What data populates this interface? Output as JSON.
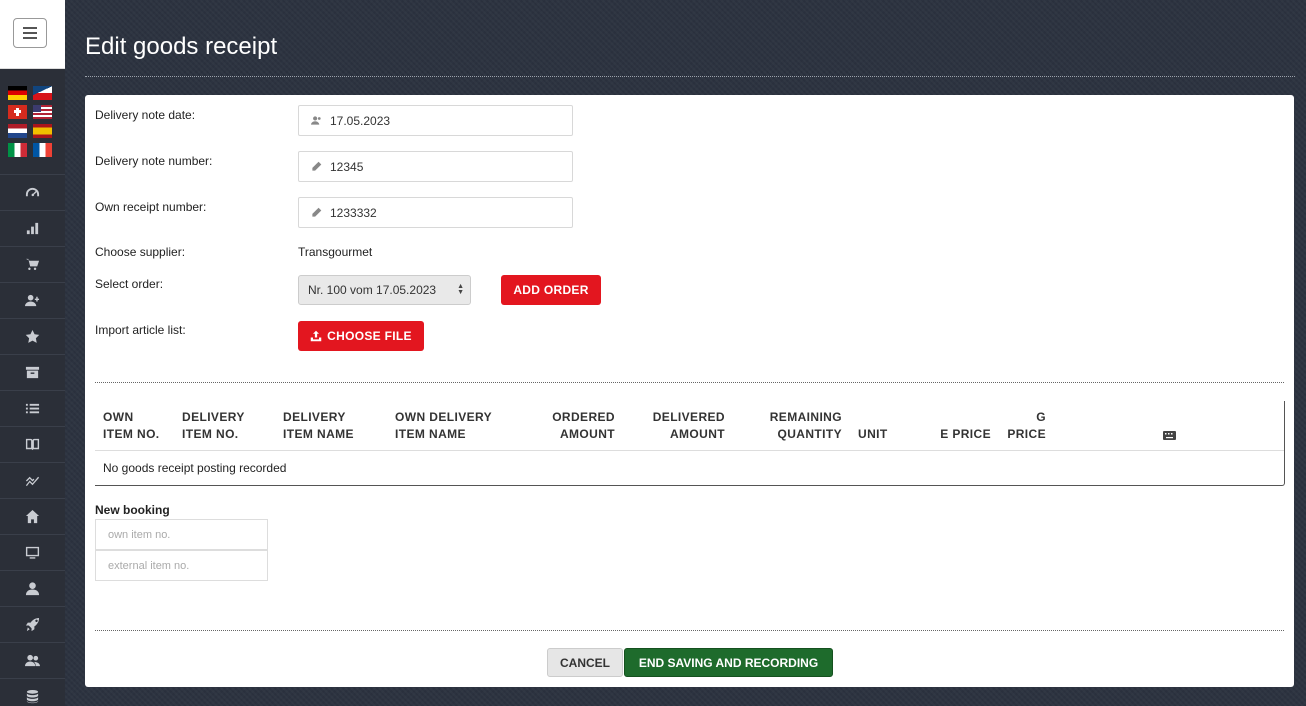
{
  "page": {
    "title": "Edit goods receipt"
  },
  "sidebar": {
    "flags": [
      "de",
      "cz",
      "ch",
      "us",
      "nl",
      "es",
      "it",
      "fr"
    ],
    "nav_icons": [
      "dashboard-icon",
      "bar-chart-icon",
      "shopping-cart-icon",
      "add-user-icon",
      "star-icon",
      "archive-icon",
      "list-icon",
      "book-icon",
      "trend-icon",
      "home-icon",
      "monitor-icon",
      "user-icon",
      "rocket-icon",
      "users-icon",
      "database-icon"
    ]
  },
  "form": {
    "delivery_date_label": "Delivery note date:",
    "delivery_date_value": "17.05.2023",
    "delivery_number_label": "Delivery note number:",
    "delivery_number_value": "12345",
    "own_receipt_label": "Own receipt number:",
    "own_receipt_value": "1233332",
    "supplier_label": "Choose supplier:",
    "supplier_value": "Transgourmet",
    "order_label": "Select order:",
    "order_value": "Nr. 100 vom 17.05.2023",
    "add_order_label": "ADD ORDER",
    "import_label": "Import article list:",
    "choose_file_label": "CHOOSE FILE"
  },
  "table": {
    "headers": {
      "own_item_no": [
        "OWN",
        "ITEM NO."
      ],
      "delivery_item_no": [
        "DELIVERY",
        "ITEM NO."
      ],
      "delivery_item_name": [
        "DELIVERY",
        "ITEM NAME"
      ],
      "own_delivery_item_name": [
        "OWN DELIVERY",
        "ITEM NAME"
      ],
      "ordered_amount": [
        "ORDERED",
        "AMOUNT"
      ],
      "delivered_amount": [
        "DELIVERED",
        "AMOUNT"
      ],
      "remaining_quantity": [
        "REMAINING",
        "QUANTITY"
      ],
      "unit": "UNIT",
      "e_price": "E PRICE",
      "g_price": [
        "G",
        "PRICE"
      ]
    },
    "empty_text": "No goods receipt posting recorded"
  },
  "new_booking": {
    "title": "New booking",
    "own_item_placeholder": "own item no.",
    "external_item_placeholder": "external item no."
  },
  "actions": {
    "cancel_label": "CANCEL",
    "save_label": "END SAVING AND RECORDING"
  },
  "colors": {
    "accent_red": "#e3161f",
    "save_green": "#1e6b2c",
    "sidebar": "#2b2f38"
  }
}
